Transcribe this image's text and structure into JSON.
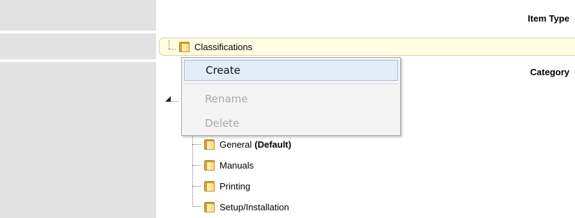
{
  "form": {
    "item_type_label": "Item Type",
    "category_label": "Category"
  },
  "tree": {
    "root_label": "Classifications",
    "children": [
      {
        "label": "General",
        "suffix": "(Default)"
      },
      {
        "label": "Manuals"
      },
      {
        "label": "Printing"
      },
      {
        "label": "Setup/Installation"
      }
    ]
  },
  "context_menu": {
    "items": [
      {
        "label": "Create",
        "state": "highlighted"
      },
      {
        "label": "Rename",
        "state": "disabled"
      },
      {
        "label": "Delete",
        "state": "disabled"
      }
    ]
  },
  "icons": {
    "folder": "folder-icon",
    "expander": "tree-expander-icon"
  },
  "colors": {
    "label_column_bg": "#e2e2e2",
    "selected_node_bg": "#fffde1",
    "folder_color": "#d9a43a",
    "menu_highlight_bg": "#e4ecf7",
    "menu_disabled_text": "#a8a8a8"
  }
}
